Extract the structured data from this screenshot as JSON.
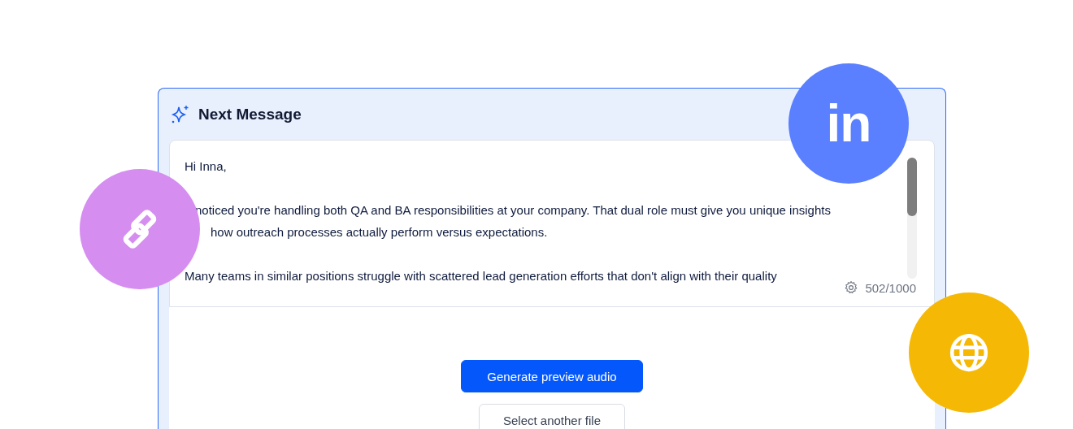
{
  "panel": {
    "title": "Next Message"
  },
  "message": {
    "lines": [
      {
        "text": "Hi Inna,",
        "kind": "plain"
      },
      {
        "kind": "blank"
      },
      {
        "text": "noticed you're handling both QA and BA responsibilities at your company. That dual role must give you unique insights",
        "kind": "covered"
      },
      {
        "text": "how outreach processes actually perform versus expectations.",
        "kind": "covered-more"
      },
      {
        "kind": "blank"
      },
      {
        "text": "Many teams in similar positions struggle with scattered lead generation efforts that don't align with their quality",
        "kind": "plain"
      }
    ],
    "counter": "502/1000"
  },
  "buttons": [
    {
      "label": "Generate preview audio",
      "kind": "primary"
    },
    {
      "label": "Select another file",
      "kind": "secondary"
    }
  ],
  "badges": [
    {
      "kind": "link",
      "color": "#d58ef0"
    },
    {
      "kind": "logo",
      "text": "in",
      "color": "#5a7fff"
    },
    {
      "kind": "globe",
      "color": "#f5b805"
    }
  ]
}
